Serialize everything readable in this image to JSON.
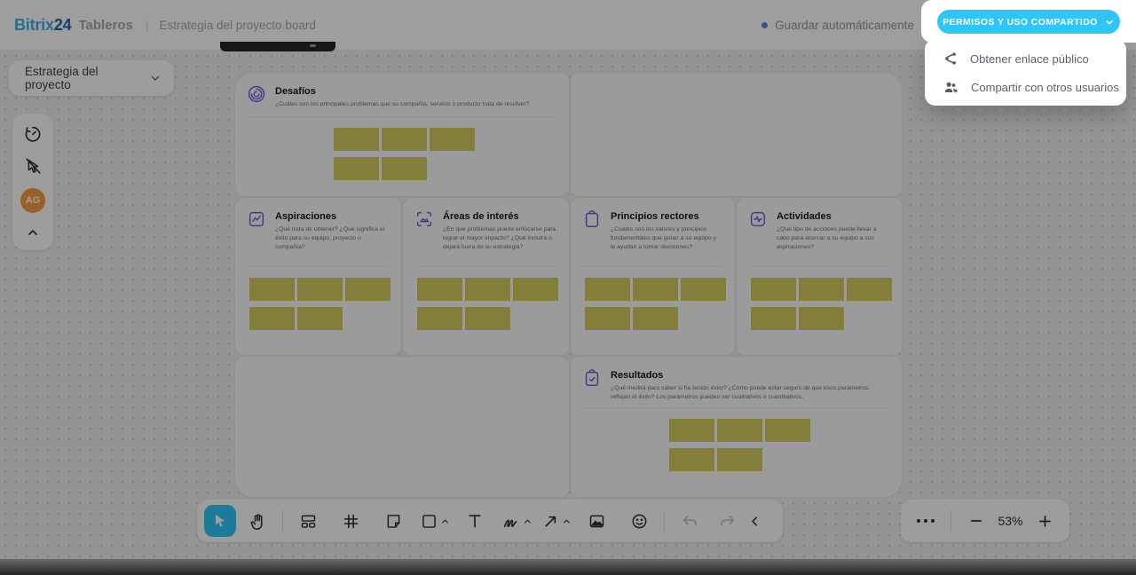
{
  "header": {
    "logo_bitrix": "Bitrix",
    "logo_24": "24",
    "app_name": "Tableros",
    "breadcrumb": "Estrategia del proyecto.board",
    "autosave_label": "Guardar automáticamente"
  },
  "share": {
    "button_label": "PERMISOS Y USO COMPARTIDO",
    "menu": [
      {
        "icon": "share-icon",
        "label": "Obtener enlace público"
      },
      {
        "icon": "user-plus-icon",
        "label": "Compartir con otros usuarios"
      }
    ]
  },
  "board_selector": {
    "label": "Estrategia del proyecto"
  },
  "left_toolbar": {
    "icons": [
      "timer-icon",
      "pointer-off-icon",
      "avatar",
      "chevron-up-icon"
    ],
    "avatar_initials": "AG"
  },
  "sections": [
    {
      "title": "Desafíos",
      "subtitle": "¿Cuáles son los principales problemas que su compañía, servicio o producto trata de resolver?",
      "icon": "maze-icon",
      "sticky_rows": [
        3,
        2
      ]
    },
    {
      "title": "Aspiraciones",
      "subtitle": "¿Qué trata de obtener? ¿Qué significa el éxito para su equipo, proyecto o compañía?",
      "icon": "chart-frame-icon",
      "sticky_rows": [
        3,
        2
      ]
    },
    {
      "title": "Áreas de interés",
      "subtitle": "¿En qué problemas puede enfocarse para lograr el mayor impacto? ¿Qué incluirá o dejará fuera de su estrategia?",
      "icon": "focus-image-icon",
      "sticky_rows": [
        3,
        2
      ]
    },
    {
      "title": "Principios rectores",
      "subtitle": "¿Cuáles son los valores y principios fundamentales que guían a su equipo y le ayudan a tomar decisiones?",
      "icon": "clipboard-icon",
      "sticky_rows": [
        3,
        2
      ]
    },
    {
      "title": "Actividades",
      "subtitle": "¿Qué tipo de acciones puede llevar a cabo para acercar a su equipo a sus aspiraciones?",
      "icon": "pulse-icon",
      "sticky_rows": [
        3,
        2
      ]
    },
    {
      "title": "Resultados",
      "subtitle": "¿Qué medirá para saber si ha tenido éxito? ¿Cómo puede estar seguro de que esos parámetros reflejan el éxito? Los parámetros pueden ser cualitativos o cuantitativos.",
      "icon": "clipboard-check-icon",
      "sticky_rows": [
        3,
        2
      ]
    }
  ],
  "toolbar": {
    "tools": [
      "select",
      "hand",
      "templates",
      "frame",
      "sticker",
      "shape",
      "text",
      "pen",
      "arrow",
      "image",
      "emoji",
      "undo",
      "redo",
      "collapse"
    ],
    "active_tool": "select"
  },
  "zoom_controls": {
    "zoom_level": "53%"
  },
  "colors": {
    "accent_cyan": "#2FC6F7",
    "sticky_yellow": "#D5CC62",
    "icon_purple": "#7457D8",
    "avatar_orange": "#F49C3F",
    "autosave_dot_blue": "#4E8EE3"
  }
}
